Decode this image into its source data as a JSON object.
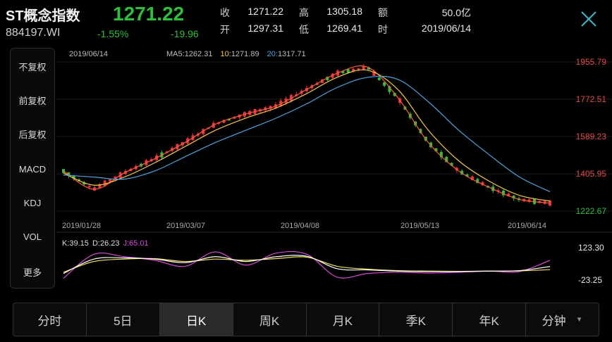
{
  "header": {
    "title": "ST概念指数",
    "code": "884197.WI",
    "price": "1271.22",
    "change_pct": "-1.55%",
    "change_abs": "-19.96"
  },
  "quote": {
    "close_label": "收",
    "close": "1271.22",
    "high_label": "高",
    "high": "1305.18",
    "amount_label": "额",
    "amount": "50.0亿",
    "open_label": "开",
    "open": "1297.31",
    "low_label": "低",
    "low": "1269.41",
    "date_label": "时",
    "date": "2019/06/14"
  },
  "sidebar": {
    "items": [
      {
        "label": "不复权",
        "active": true
      },
      {
        "label": "前复权",
        "active": false
      },
      {
        "label": "后复权",
        "active": false
      },
      {
        "label": "MACD",
        "active": false
      },
      {
        "label": "KDJ",
        "active": true
      },
      {
        "label": "VOL",
        "active": false
      },
      {
        "label": "更多",
        "active": false
      }
    ]
  },
  "chart": {
    "date": "2019/06/14",
    "ma5_label": "MA5:",
    "ma5_value": "1262.31",
    "ma10_label": "10:",
    "ma10_value": "1271.89",
    "ma20_label": "20:",
    "ma20_value": "1317.71",
    "y_ticks": [
      "1955.79",
      "1772.51",
      "1589.23",
      "1405.95",
      "1222.67"
    ],
    "x_ticks": [
      "2019/01/28",
      "2019/03/07",
      "2019/04/08",
      "2019/05/13",
      "2019/06/14"
    ],
    "kdj_k": "K:39.15",
    "kdj_d": "D:26.23",
    "kdj_j": "J:65.01",
    "kdj_ticks": [
      "123.30",
      "-23.25"
    ],
    "colors": {
      "up": "#e8333a",
      "down": "#2fbf3d",
      "ma5": "#ff5a3c",
      "ma10": "#f2c94c",
      "ma20": "#4aa3e0",
      "k": "#ffffff",
      "d": "#f2e25a",
      "j": "#d94bd6",
      "tick_price": "#e34a4a",
      "tick_low": "#2fbf3d"
    }
  },
  "chart_data": {
    "type": "line",
    "title": "",
    "xlabel": "",
    "ylabel": "",
    "x_tick_labels": [
      "2019/01/28",
      "2019/03/07",
      "2019/04/08",
      "2019/05/13",
      "2019/06/14"
    ],
    "ylim": [
      1222.67,
      1955.79
    ],
    "series": [
      {
        "name": "MA5",
        "values": [
          1420,
          1330,
          1410,
          1480,
          1560,
          1650,
          1700,
          1740,
          1820,
          1900,
          1930,
          1780,
          1560,
          1420,
          1340,
          1280,
          1262
        ]
      },
      {
        "name": "10",
        "values": [
          1410,
          1350,
          1390,
          1460,
          1540,
          1620,
          1680,
          1730,
          1800,
          1880,
          1915,
          1820,
          1620,
          1470,
          1370,
          1300,
          1272
        ]
      },
      {
        "name": "20",
        "values": [
          1400,
          1390,
          1380,
          1420,
          1490,
          1560,
          1620,
          1680,
          1750,
          1830,
          1880,
          1870,
          1760,
          1620,
          1500,
          1390,
          1318
        ]
      }
    ],
    "kdj": {
      "ylim": [
        -23.25,
        123.3
      ],
      "K": [
        10,
        70,
        75,
        70,
        55,
        80,
        60,
        80,
        82,
        30,
        25,
        20,
        18,
        18,
        20,
        22,
        39
      ],
      "D": [
        15,
        60,
        70,
        72,
        60,
        70,
        65,
        72,
        78,
        40,
        28,
        22,
        20,
        19,
        20,
        21,
        26
      ],
      "J": [
        -10,
        90,
        80,
        65,
        40,
        100,
        45,
        95,
        90,
        -5,
        10,
        15,
        12,
        15,
        20,
        18,
        65
      ]
    }
  },
  "tabs": [
    {
      "label": "分时",
      "active": false
    },
    {
      "label": "5日",
      "active": false
    },
    {
      "label": "日K",
      "active": true
    },
    {
      "label": "周K",
      "active": false
    },
    {
      "label": "月K",
      "active": false
    },
    {
      "label": "季K",
      "active": false
    },
    {
      "label": "年K",
      "active": false
    },
    {
      "label": "分钟",
      "active": false
    }
  ]
}
